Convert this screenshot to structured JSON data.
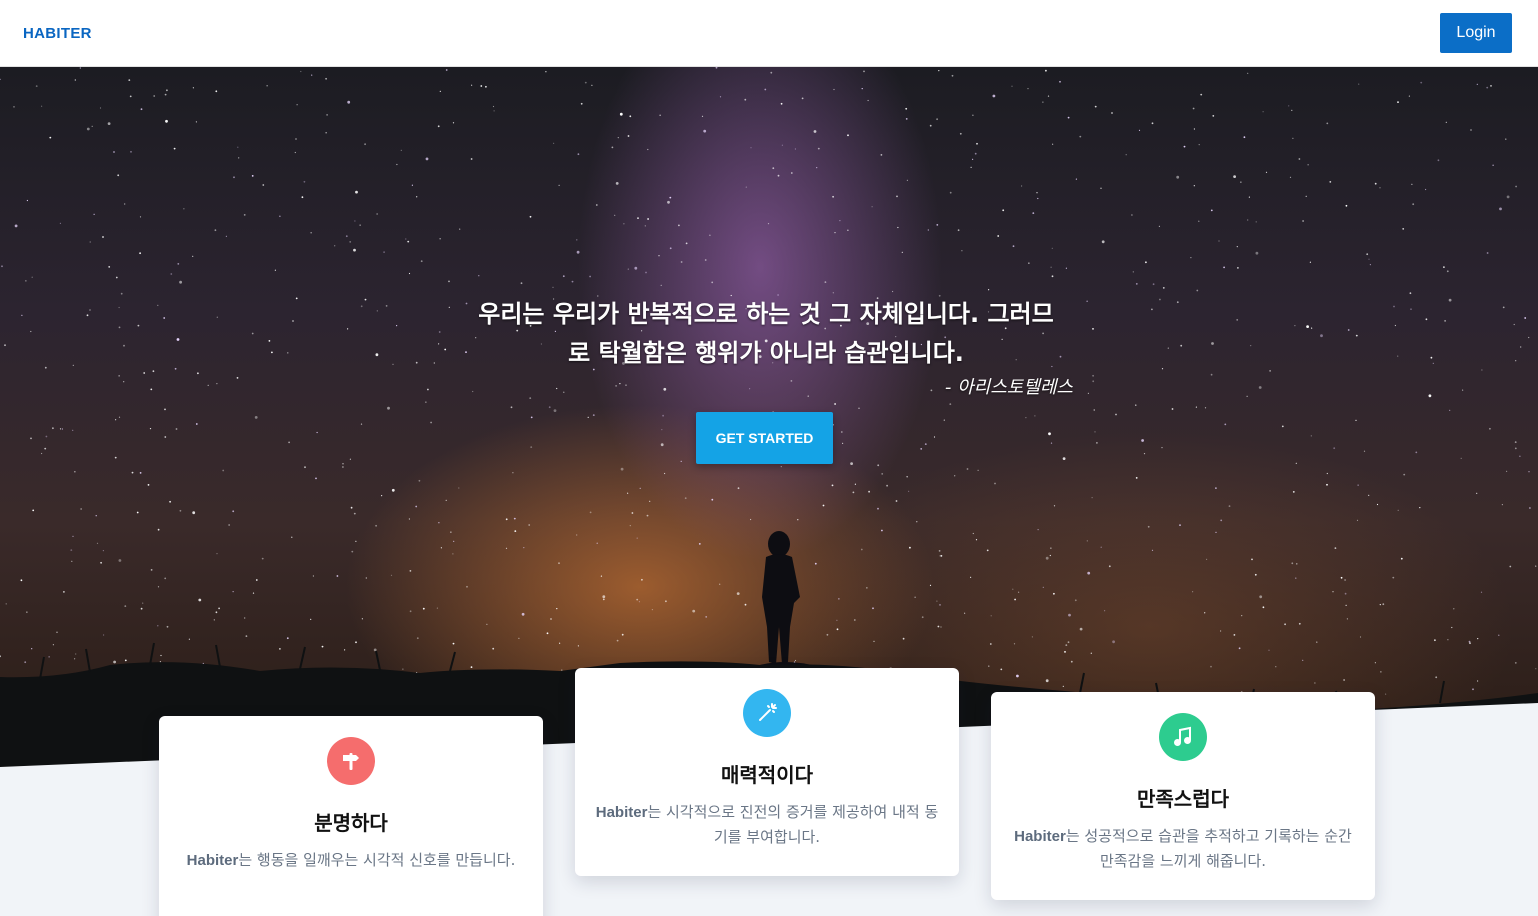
{
  "navbar": {
    "brand": "HABITER",
    "login_label": "Login"
  },
  "hero": {
    "quote_line1": "우리는 우리가 반복적으로 하는 것 그 자체입니다. 그러므",
    "quote_line2": "로 탁월함은 행위가 아니라 습관입니다.",
    "author": "- 아리스토텔레스",
    "cta_label": "GET STARTED"
  },
  "cards": [
    {
      "icon": "signpost-icon",
      "icon_color": "#f56d6d",
      "title": "분명하다",
      "brand": "Habiter",
      "text": "는 행동을 일깨우는 시각적 신호를 만듭니다."
    },
    {
      "icon": "magic-wand-icon",
      "icon_color": "#33b6f0",
      "title": "매력적이다",
      "brand": "Habiter",
      "text": "는 시각적으로 진전의 증거를 제공하여 내적 동기를 부여합니다."
    },
    {
      "icon": "music-note-icon",
      "icon_color": "#2dcc8f",
      "title": "만족스럽다",
      "brand": "Habiter",
      "text": "는 성공적으로 습관을 추적하고 기록하는 순간 만족감을 느끼게 해줍니다."
    }
  ],
  "colors": {
    "brand": "#0a66c2",
    "login_button": "#0b6ec7",
    "cta_button": "#14a3e6",
    "page_background": "#f1f4f8"
  }
}
